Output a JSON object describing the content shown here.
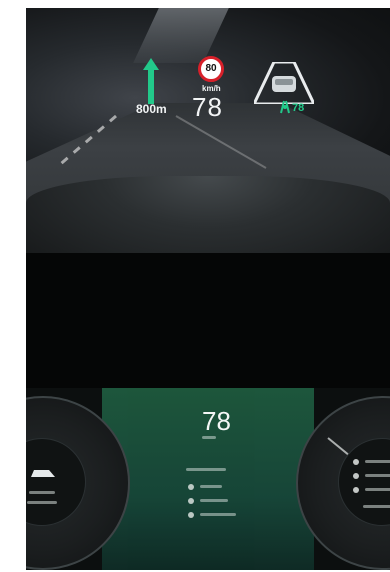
{
  "hud": {
    "nav_distance": "800m",
    "speed_limit": "80",
    "speed_unit": "km/h",
    "current_speed": "78",
    "lane_speed": "78"
  },
  "cluster": {
    "speed": "78"
  },
  "colors": {
    "hud_accent": "#22c98a",
    "speed_limit_ring": "#d8202a",
    "cluster_center": "#1e5a3e"
  }
}
